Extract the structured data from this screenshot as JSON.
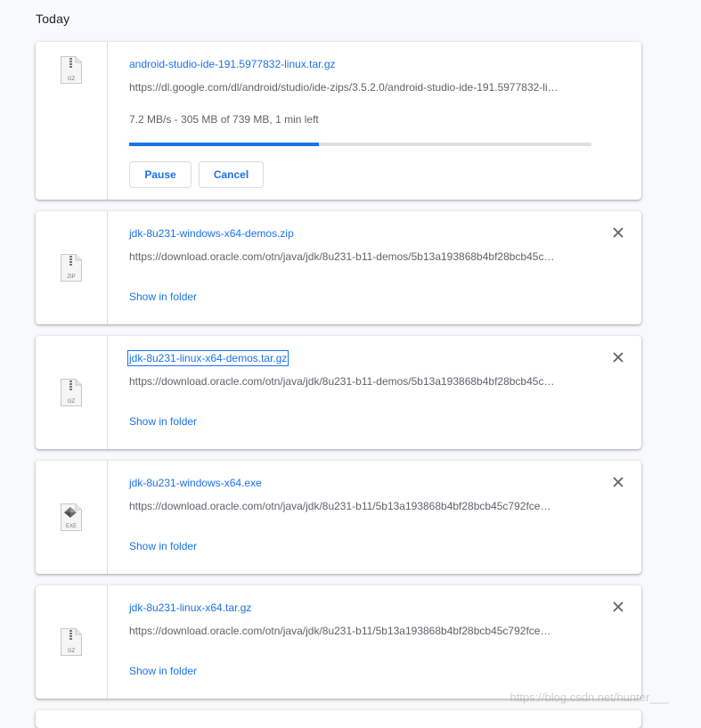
{
  "section_title": "Today",
  "colors": {
    "accent": "#1a73e8",
    "text_secondary": "#5f6368",
    "track": "#e0e0e0"
  },
  "downloads": [
    {
      "name": "android-studio-ide-191.5977832-linux.tar.gz",
      "url": "https://dl.google.com/dl/android/studio/ide-zips/3.5.2.0/android-studio-ide-191.5977832-li…",
      "icon": "archive-file-icon",
      "icon_label": "GZ",
      "status": "7.2 MB/s - 305 MB of 739 MB, 1 min left",
      "progress_fraction": 0.41,
      "pause_label": "Pause",
      "cancel_label": "Cancel"
    },
    {
      "name": "jdk-8u231-windows-x64-demos.zip",
      "url": "https://download.oracle.com/otn/java/jdk/8u231-b11-demos/5b13a193868b4bf28bcb45c…",
      "icon": "archive-file-icon",
      "icon_label": "ZIP",
      "show_in_folder": "Show in folder"
    },
    {
      "name": "jdk-8u231-linux-x64-demos.tar.gz",
      "url": "https://download.oracle.com/otn/java/jdk/8u231-b11-demos/5b13a193868b4bf28bcb45c…",
      "icon": "archive-file-icon",
      "icon_label": "GZ",
      "show_in_folder": "Show in folder"
    },
    {
      "name": "jdk-8u231-windows-x64.exe",
      "url": "https://download.oracle.com/otn/java/jdk/8u231-b11/5b13a193868b4bf28bcb45c792fce…",
      "icon": "executable-file-icon",
      "icon_label": "EXE",
      "show_in_folder": "Show in folder"
    },
    {
      "name": "jdk-8u231-linux-x64.tar.gz",
      "url": "https://download.oracle.com/otn/java/jdk/8u231-b11/5b13a193868b4bf28bcb45c792fce…",
      "icon": "archive-file-icon",
      "icon_label": "GZ",
      "show_in_folder": "Show in folder"
    }
  ],
  "watermark": "https://blog.csdn.net/hunter___"
}
